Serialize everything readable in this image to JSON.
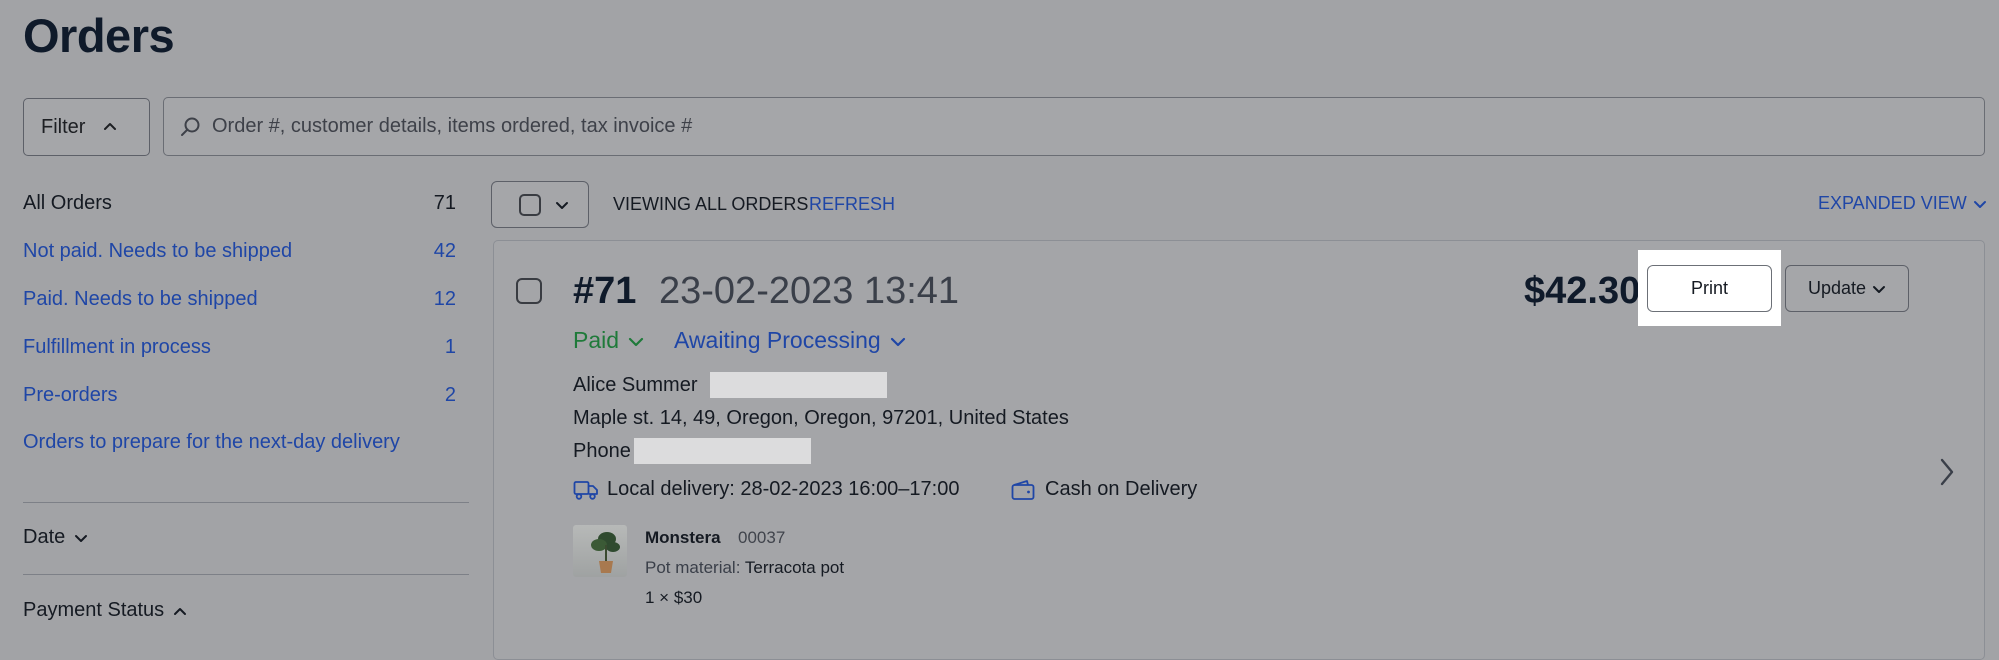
{
  "page": {
    "title": "Orders"
  },
  "toolbar": {
    "filter_label": "Filter",
    "search_placeholder": "Order #, customer details, items ordered, tax invoice #"
  },
  "sidebar": {
    "items": [
      {
        "label": "All Orders",
        "count": "71"
      },
      {
        "label": "Not paid. Needs to be shipped",
        "count": "42"
      },
      {
        "label": "Paid. Needs to be shipped",
        "count": "12"
      },
      {
        "label": "Fulfillment in process",
        "count": "1"
      },
      {
        "label": "Pre-orders",
        "count": "2"
      },
      {
        "label": "Orders to prepare for the next-day delivery",
        "count": ""
      }
    ],
    "sections": [
      {
        "label": "Date"
      },
      {
        "label": "Payment Status"
      }
    ]
  },
  "list": {
    "viewing_label": "VIEWING ALL ORDERS",
    "refresh_label": "REFRESH",
    "view_mode_label": "EXPANDED VIEW"
  },
  "order": {
    "number": "#71",
    "date": "23-02-2023 13:41",
    "total": "$42.30",
    "print_label": "Print",
    "update_label": "Update",
    "payment_status": "Paid",
    "fulfillment_status": "Awaiting Processing",
    "customer_name": "Alice Summer",
    "address": "Maple st. 14, 49, Oregon, Oregon, 97201, United States",
    "phone_label": "Phone",
    "delivery": "Local delivery: 28-02-2023 16:00–17:00",
    "payment_method": "Cash on Delivery",
    "items": [
      {
        "name": "Monstera",
        "sku": "00037",
        "option_label": "Pot material:",
        "option_value": "Terracota pot",
        "qty_price": "1 × $30"
      }
    ]
  },
  "colors": {
    "accent": "#1f46a6",
    "paid": "#1f7a3a",
    "backdrop": "#a2a3a6",
    "highlight": "#ffffff"
  }
}
